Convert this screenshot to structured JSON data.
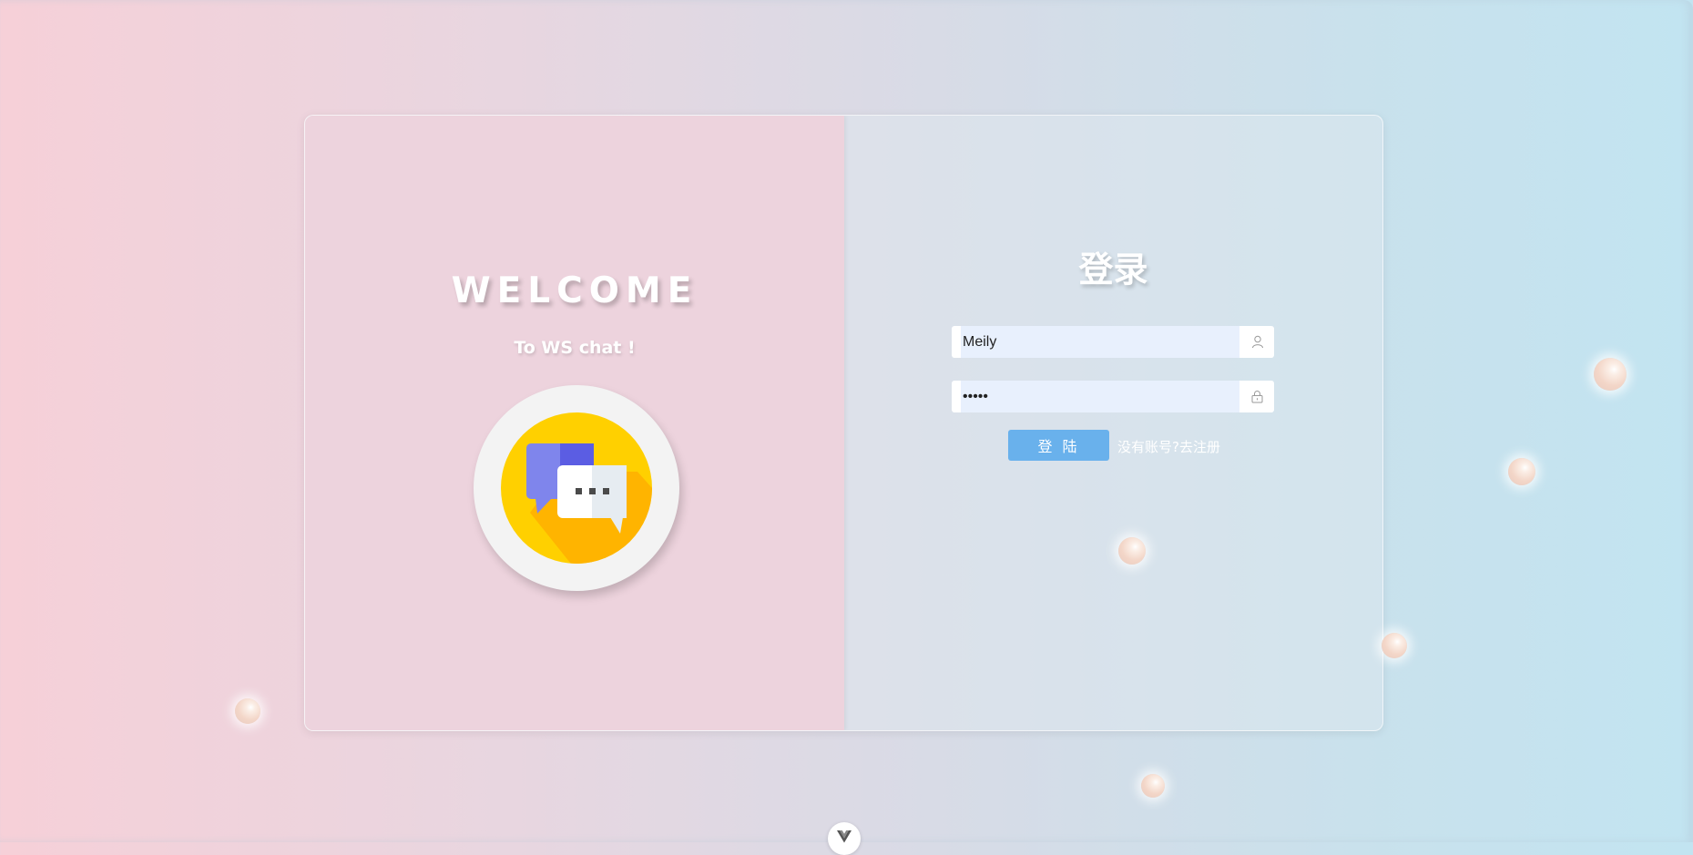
{
  "left_panel": {
    "welcome": "WELCOME",
    "subtitle": "To WS chat !",
    "logo_icon": "chat-bubbles-icon"
  },
  "login": {
    "title": "登录",
    "username": {
      "value": "Meily",
      "icon": "user-icon"
    },
    "password": {
      "value": "•••••",
      "icon": "lock-icon"
    },
    "submit_label": "登 陆",
    "register_label": "没有账号?去注册"
  },
  "colors": {
    "gradient_left": "#f6d0d8",
    "gradient_right": "#c2e4f1",
    "left_panel_bg": "#edd3dd",
    "button_bg": "#69b1ec",
    "input_bg": "#e8f0fd",
    "logo_yellow": "#ffd000",
    "logo_purple": "#6f6ee8"
  },
  "decor": {
    "bubble_icon": "floating-bubble",
    "corner_icon": "vue-logo-icon"
  }
}
